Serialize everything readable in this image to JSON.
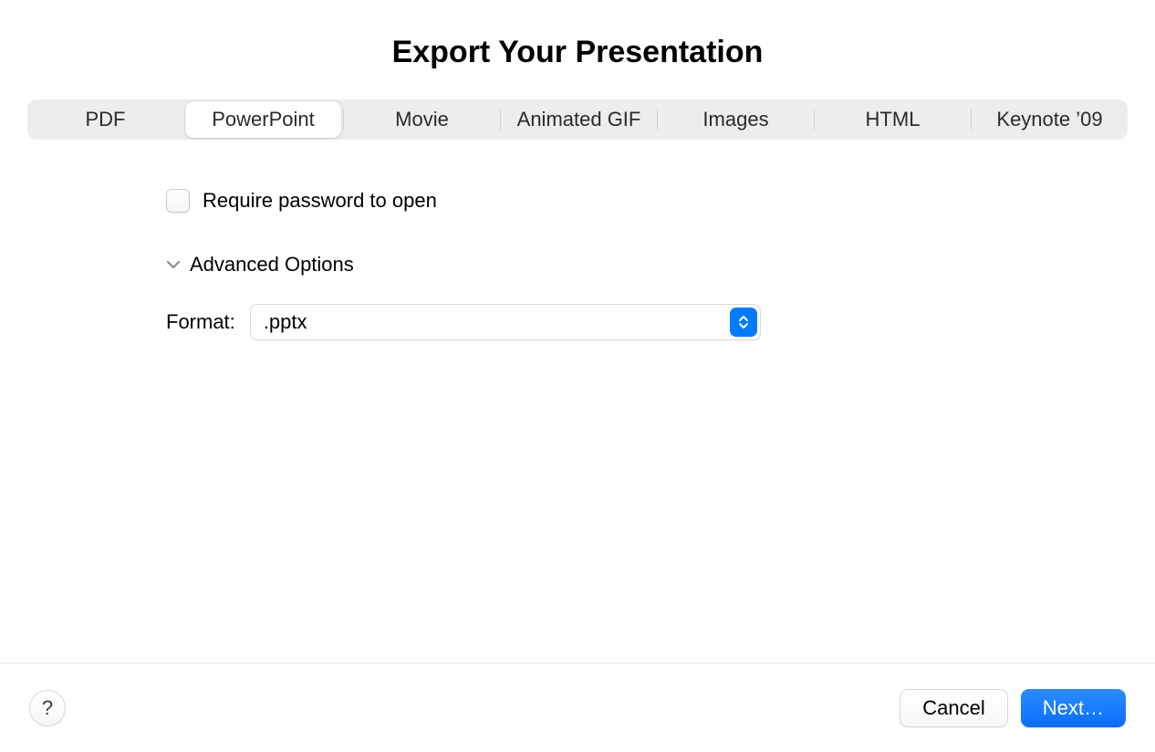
{
  "dialog": {
    "title": "Export Your Presentation"
  },
  "tabs": {
    "items": [
      {
        "label": "PDF"
      },
      {
        "label": "PowerPoint"
      },
      {
        "label": "Movie"
      },
      {
        "label": "Animated GIF"
      },
      {
        "label": "Images"
      },
      {
        "label": "HTML"
      },
      {
        "label": "Keynote ’09"
      }
    ],
    "active_index": 1
  },
  "options": {
    "require_password_label": "Require password to open",
    "require_password_checked": false,
    "advanced_label": "Advanced Options",
    "format_label": "Format:",
    "format_value": ".pptx"
  },
  "footer": {
    "help_label": "?",
    "cancel_label": "Cancel",
    "next_label": "Next…"
  }
}
